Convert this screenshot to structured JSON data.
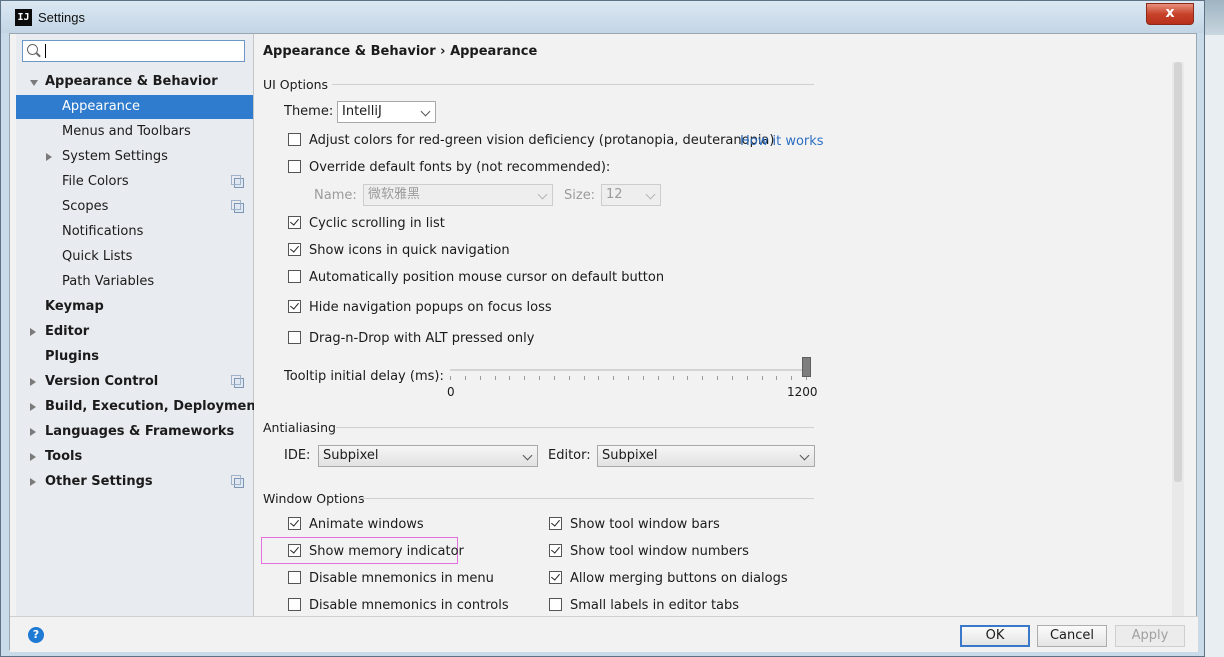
{
  "window": {
    "title": "Settings",
    "app_icon_text": "IJ",
    "close_label": "x"
  },
  "search": {
    "value": ""
  },
  "sidebar": {
    "items": [
      {
        "label": "Appearance & Behavior",
        "level": 0,
        "bold": true,
        "arrow": "down",
        "selected": false,
        "copy": false
      },
      {
        "label": "Appearance",
        "level": 1,
        "bold": false,
        "arrow": "",
        "selected": true,
        "copy": false
      },
      {
        "label": "Menus and Toolbars",
        "level": 1,
        "bold": false,
        "arrow": "",
        "selected": false,
        "copy": false
      },
      {
        "label": "System Settings",
        "level": 1,
        "bold": false,
        "arrow": "right",
        "selected": false,
        "copy": false
      },
      {
        "label": "File Colors",
        "level": 1,
        "bold": false,
        "arrow": "",
        "selected": false,
        "copy": true
      },
      {
        "label": "Scopes",
        "level": 1,
        "bold": false,
        "arrow": "",
        "selected": false,
        "copy": true
      },
      {
        "label": "Notifications",
        "level": 1,
        "bold": false,
        "arrow": "",
        "selected": false,
        "copy": false
      },
      {
        "label": "Quick Lists",
        "level": 1,
        "bold": false,
        "arrow": "",
        "selected": false,
        "copy": false
      },
      {
        "label": "Path Variables",
        "level": 1,
        "bold": false,
        "arrow": "",
        "selected": false,
        "copy": false
      },
      {
        "label": "Keymap",
        "level": 0,
        "bold": true,
        "arrow": "",
        "selected": false,
        "copy": false
      },
      {
        "label": "Editor",
        "level": 0,
        "bold": true,
        "arrow": "right",
        "selected": false,
        "copy": false
      },
      {
        "label": "Plugins",
        "level": 0,
        "bold": true,
        "arrow": "",
        "selected": false,
        "copy": false
      },
      {
        "label": "Version Control",
        "level": 0,
        "bold": true,
        "arrow": "right",
        "selected": false,
        "copy": true
      },
      {
        "label": "Build, Execution, Deployment",
        "level": 0,
        "bold": true,
        "arrow": "right",
        "selected": false,
        "copy": false
      },
      {
        "label": "Languages & Frameworks",
        "level": 0,
        "bold": true,
        "arrow": "right",
        "selected": false,
        "copy": false
      },
      {
        "label": "Tools",
        "level": 0,
        "bold": true,
        "arrow": "right",
        "selected": false,
        "copy": false
      },
      {
        "label": "Other Settings",
        "level": 0,
        "bold": true,
        "arrow": "right",
        "selected": false,
        "copy": true
      }
    ]
  },
  "breadcrumb": {
    "parent": "Appearance & Behavior",
    "separator": "›",
    "current": "Appearance"
  },
  "ui_options": {
    "title": "UI Options",
    "theme_label": "Theme:",
    "theme_value": "IntelliJ",
    "adjust_colors": {
      "label": "Adjust colors for red-green vision deficiency (protanopia, deuteranopia)",
      "checked": false
    },
    "how_it_works": "How it works",
    "override_fonts": {
      "label": "Override default fonts by (not recommended):",
      "checked": false
    },
    "font_name_label": "Name:",
    "font_name_value": "微软雅黑",
    "font_size_label": "Size:",
    "font_size_value": "12",
    "cyclic_scrolling": {
      "label": "Cyclic scrolling in list",
      "checked": true
    },
    "show_icons": {
      "label": "Show icons in quick navigation",
      "checked": true
    },
    "auto_position_mouse": {
      "label": "Automatically position mouse cursor on default button",
      "checked": false
    },
    "hide_nav_popups": {
      "label": "Hide navigation popups on focus loss",
      "checked": true
    },
    "drag_n_drop": {
      "label": "Drag-n-Drop with ALT pressed only",
      "checked": false
    },
    "tooltip_delay_label": "Tooltip initial delay (ms):",
    "tooltip_min": "0",
    "tooltip_max": "1200",
    "tooltip_value": 1200
  },
  "antialiasing": {
    "title": "Antialiasing",
    "ide_label": "IDE:",
    "ide_value": "Subpixel",
    "editor_label": "Editor:",
    "editor_value": "Subpixel"
  },
  "window_options": {
    "title": "Window Options",
    "animate_windows": {
      "label": "Animate windows",
      "checked": true
    },
    "show_memory_indicator": {
      "label": "Show memory indicator",
      "checked": true
    },
    "disable_mnemonics_menu": {
      "label": "Disable mnemonics in menu",
      "checked": false
    },
    "disable_mnemonics_controls": {
      "label": "Disable mnemonics in controls",
      "checked": false
    },
    "show_tool_window_bars": {
      "label": "Show tool window bars",
      "checked": true
    },
    "show_tool_window_numbers": {
      "label": "Show tool window numbers",
      "checked": true
    },
    "allow_merging_buttons": {
      "label": "Allow merging buttons on dialogs",
      "checked": true
    },
    "small_labels": {
      "label": "Small labels in editor tabs",
      "checked": false
    }
  },
  "footer": {
    "help_label": "?",
    "ok": "OK",
    "cancel": "Cancel",
    "apply": "Apply"
  },
  "colors": {
    "selection": "#2f7bcd",
    "link": "#2e6fc2",
    "highlight_box": "#e56ee1",
    "help": "#1f7ad3"
  }
}
